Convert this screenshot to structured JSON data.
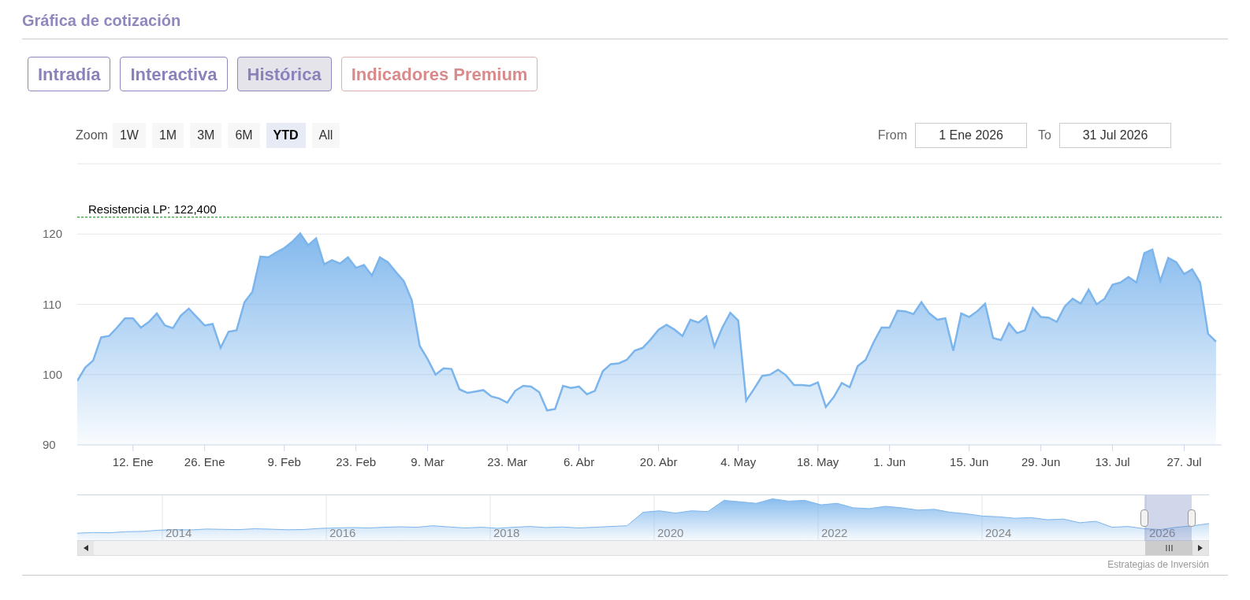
{
  "header": {
    "title": "Gráfica de cotización"
  },
  "tabs": [
    {
      "label": "Intradía",
      "selected": false,
      "kind": "normal"
    },
    {
      "label": "Interactiva",
      "selected": false,
      "kind": "normal"
    },
    {
      "label": "Histórica",
      "selected": true,
      "kind": "normal"
    },
    {
      "label": "Indicadores Premium",
      "selected": false,
      "kind": "premium"
    }
  ],
  "range_selector": {
    "label": "Zoom",
    "buttons": [
      {
        "label": "1W",
        "selected": false
      },
      {
        "label": "1M",
        "selected": false
      },
      {
        "label": "3M",
        "selected": false
      },
      {
        "label": "6M",
        "selected": false
      },
      {
        "label": "YTD",
        "selected": true
      },
      {
        "label": "All",
        "selected": false
      }
    ],
    "from_label": "From",
    "from_value": "1 Ene 2026",
    "to_label": "To",
    "to_value": "31 Jul 2026"
  },
  "chart": {
    "chart_data": {
      "type": "area",
      "ylim": [
        90,
        130
      ],
      "grid": true,
      "yticks": [
        90,
        100,
        110,
        120
      ],
      "categories": [
        null,
        null,
        null,
        null,
        null,
        null,
        null,
        "12. Ene",
        null,
        null,
        null,
        null,
        null,
        null,
        null,
        null,
        "26. Ene",
        null,
        null,
        null,
        null,
        null,
        null,
        null,
        null,
        null,
        "9. Feb",
        null,
        null,
        null,
        null,
        null,
        null,
        null,
        null,
        "23. Feb",
        null,
        null,
        null,
        null,
        null,
        null,
        null,
        null,
        "9. Mar",
        null,
        null,
        null,
        null,
        null,
        null,
        null,
        null,
        null,
        "23. Mar",
        null,
        null,
        null,
        null,
        null,
        null,
        null,
        null,
        "6. Abr",
        null,
        null,
        null,
        null,
        null,
        null,
        null,
        null,
        null,
        "20. Abr",
        null,
        null,
        null,
        null,
        null,
        null,
        null,
        null,
        null,
        "4. May",
        null,
        null,
        null,
        null,
        null,
        null,
        null,
        null,
        null,
        "18. May",
        null,
        null,
        null,
        null,
        null,
        null,
        null,
        null,
        "1. Jun",
        null,
        null,
        null,
        null,
        null,
        null,
        null,
        null,
        null,
        "15. Jun",
        null,
        null,
        null,
        null,
        null,
        null,
        null,
        null,
        "29. Jun",
        null,
        null,
        null,
        null,
        null,
        null,
        null,
        null,
        "13. Jul",
        null,
        null,
        null,
        null,
        null,
        null,
        null,
        null,
        "27. Jul",
        null,
        null,
        null,
        null
      ],
      "series": [
        {
          "color": "#7cb5ec",
          "values": [
            99.1,
            101,
            102,
            105.3,
            105.5,
            106.7,
            108,
            108,
            106.7,
            107.5,
            108.7,
            107,
            106.6,
            108.4,
            109.4,
            108.2,
            107,
            107.2,
            103.8,
            106.1,
            106.3,
            110.3,
            111.8,
            116.8,
            116.7,
            117.4,
            118,
            118.9,
            120.1,
            118.4,
            119.4,
            115.7,
            116.3,
            115.8,
            116.7,
            115.2,
            115.6,
            114.1,
            116.7,
            116,
            114.6,
            113.3,
            110.6,
            104.1,
            102.2,
            100,
            100.9,
            100.8,
            97.9,
            97.4,
            97.6,
            97.8,
            96.9,
            96.6,
            96,
            97.7,
            98.4,
            98.3,
            97.5,
            94.9,
            95.1,
            98.4,
            98.1,
            98.3,
            97.2,
            97.7,
            100.5,
            101.5,
            101.6,
            102.1,
            103.4,
            103.8,
            105,
            106.4,
            107.1,
            106.4,
            105.5,
            107.8,
            107.4,
            108.3,
            104,
            106.7,
            108.8,
            107.7,
            96.3,
            98,
            99.8,
            100,
            100.7,
            99.9,
            98.5,
            98.5,
            98.4,
            98.9,
            95.4,
            96.8,
            98.8,
            98.2,
            101.2,
            102.1,
            104.6,
            106.7,
            106.7,
            109.1,
            109,
            108.6,
            110.3,
            108.7,
            107.8,
            108,
            103.4,
            108.7,
            108.2,
            109,
            110.1,
            105.2,
            104.9,
            107.3,
            105.9,
            106.3,
            109.5,
            108.2,
            108.1,
            107.5,
            109.7,
            110.8,
            110.1,
            112.1,
            110,
            110.8,
            112.8,
            113.1,
            113.9,
            113.1,
            117.3,
            117.8,
            113.3,
            116.6,
            116,
            114.3,
            115,
            113.1,
            105.8,
            104.7
          ]
        }
      ],
      "ref_lines": [
        {
          "axis": "y",
          "value": 122.4,
          "label": "Resistencia LP: 122,400",
          "color": "#008000"
        }
      ]
    }
  },
  "navigator": {
    "years": [
      "2014",
      "2016",
      "2018",
      "2020",
      "2022",
      "2024",
      "2026"
    ]
  },
  "credit": "Estrategias de Inversión"
}
